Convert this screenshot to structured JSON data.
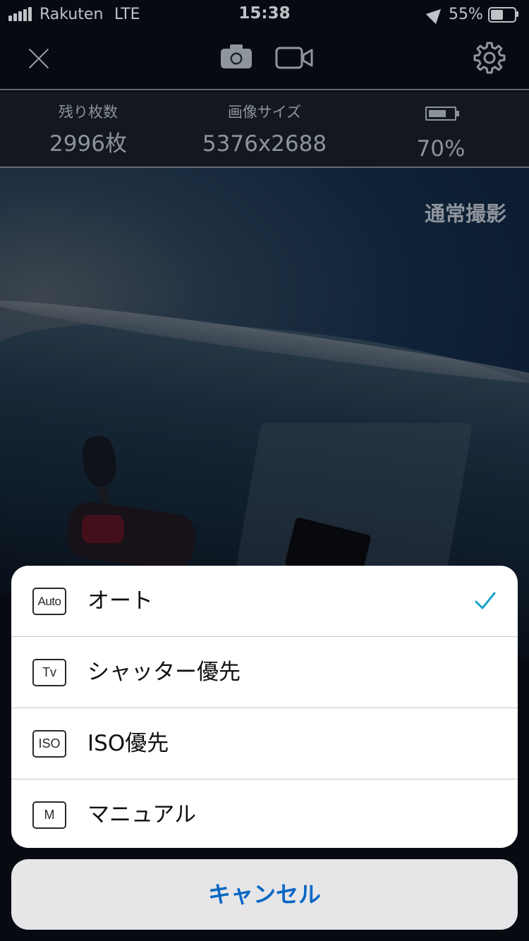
{
  "status_bar": {
    "carrier": "Rakuten",
    "network": "LTE",
    "time": "15:38",
    "battery_percent": "55%",
    "icons": [
      "signal-icon",
      "location-icon",
      "battery-icon"
    ]
  },
  "toolbar": {
    "icons": [
      "close-icon",
      "camera-icon",
      "video-icon",
      "gear-icon"
    ]
  },
  "info": {
    "remaining_label": "残り枚数",
    "remaining_value": "2996枚",
    "size_label": "画像サイズ",
    "size_value": "5376x2688",
    "battery_value": "70%",
    "battery_level": 0.7
  },
  "mode_label": "通常撮影",
  "sheet": {
    "items": [
      {
        "icon_text": "Auto",
        "label": "オート",
        "selected": true
      },
      {
        "icon_text": "Tv",
        "label": "シャッター優先",
        "selected": false
      },
      {
        "icon_text": "ISO",
        "label": "ISO優先",
        "selected": false
      },
      {
        "icon_text": "M",
        "label": "マニュアル",
        "selected": false
      }
    ],
    "cancel_label": "キャンセル"
  },
  "colors": {
    "accent": "#0a67c4",
    "check": "#1aa3c9"
  }
}
